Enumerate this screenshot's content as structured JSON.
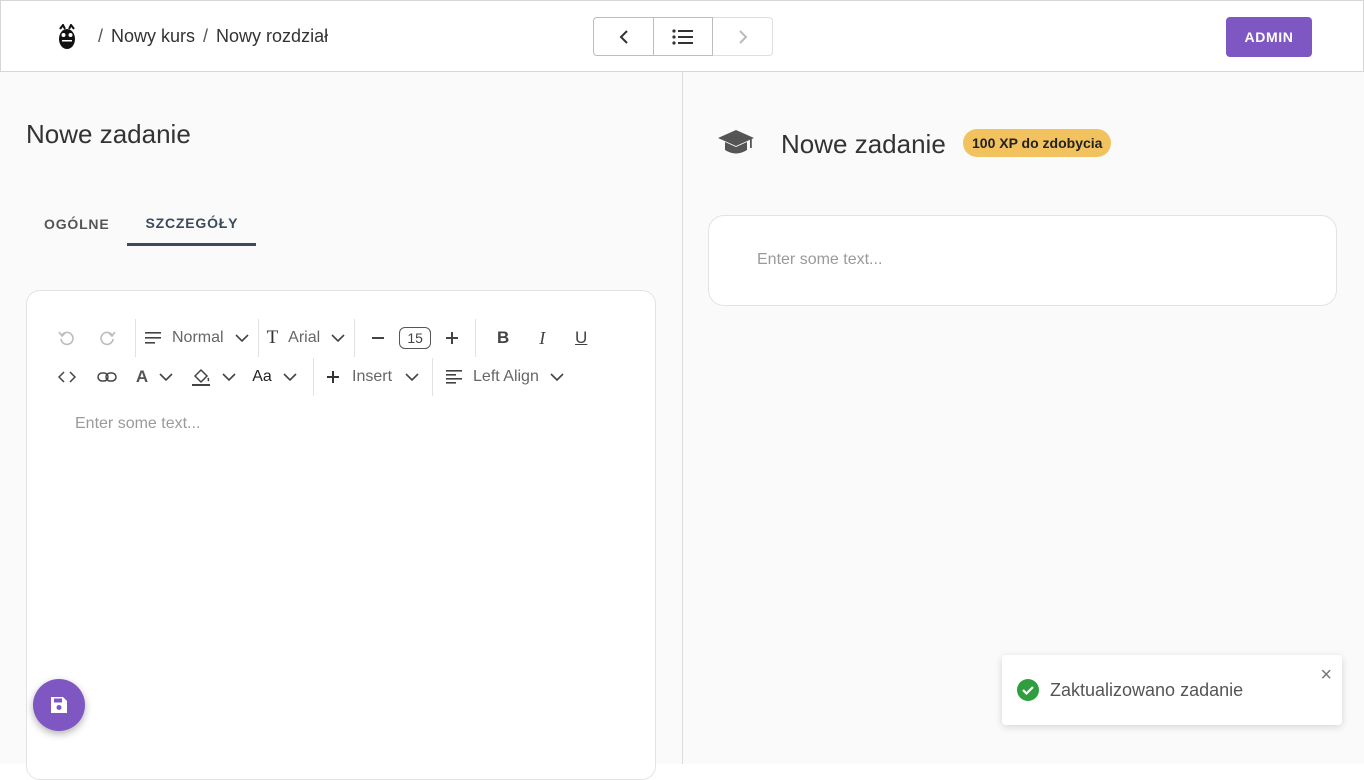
{
  "header": {
    "breadcrumbs": [
      "Nowy kurs",
      "Nowy rozdział"
    ],
    "separator": "/",
    "admin_label": "ADMIN"
  },
  "editor_panel": {
    "title": "Nowe zadanie",
    "tabs": [
      {
        "label": "OGÓLNE",
        "active": false
      },
      {
        "label": "SZCZEGÓŁY",
        "active": true
      }
    ],
    "toolbar": {
      "block_type": "Normal",
      "font_family": "Arial",
      "font_size": "15",
      "insert_label": "Insert",
      "align_label": "Left Align",
      "bold_glyph": "B",
      "italic_glyph": "I",
      "underline_glyph": "U",
      "case_glyph": "Aa",
      "text_color_glyph": "A",
      "font_glyph": "T"
    },
    "placeholder": "Enter some text..."
  },
  "preview_panel": {
    "title": "Nowe zadanie",
    "xp_badge": "100 XP do zdobycia",
    "placeholder": "Enter some text..."
  },
  "toast": {
    "message": "Zaktualizowano zadanie",
    "close_glyph": "×"
  },
  "colors": {
    "accent": "#7e57c2",
    "badge": "#f2c25e",
    "success": "#2e9e3e"
  }
}
